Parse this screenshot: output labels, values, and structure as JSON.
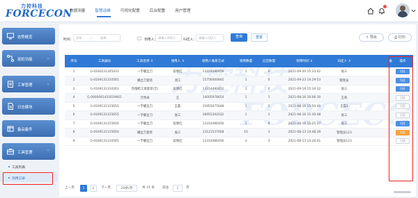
{
  "brand": {
    "cn": "力控科技",
    "en": "FORCECON"
  },
  "nav": [
    {
      "label": "数据测量",
      "active": false
    },
    {
      "label": "智慧运维",
      "active": true
    },
    {
      "label": "可视化配置",
      "active": false
    },
    {
      "label": "后台配置",
      "active": false
    },
    {
      "label": "用户管理",
      "active": false
    }
  ],
  "sidebar": {
    "items": [
      {
        "label": "态势概览",
        "icon": "monitor-icon"
      },
      {
        "label": "巡检功能",
        "icon": "route-icon"
      },
      {
        "label": "工单管理",
        "icon": "clipboard-icon"
      },
      {
        "label": "日志模块",
        "icon": "document-icon"
      },
      {
        "label": "备品备件",
        "icon": "box-icon"
      },
      {
        "label": "工具管理",
        "icon": "toolbox-icon"
      }
    ],
    "sub_items": [
      {
        "label": "工具列表",
        "active": false
      },
      {
        "label": "领用记录",
        "active": true
      }
    ]
  },
  "filters": {
    "time_label": "时间：",
    "start_placeholder": "开始",
    "separator": "—",
    "end_placeholder": "结束",
    "receiver_label": "领用人：",
    "receiver_placeholder": "请输入领用人",
    "returner_label": "归还人：",
    "returner_placeholder": "请输入归还人",
    "query_label": "查询",
    "reset_label": "重置",
    "export_label": "导出",
    "print_label": "打印"
  },
  "table": {
    "columns": [
      "序号",
      "工具编号",
      "工具名称 ⇕",
      "领用人 ⇕",
      "领用人联系方式",
      "领用数量",
      "已还数量",
      "领用时间 ⇕",
      "归还人 ⇕",
      "备",
      "操作"
    ],
    "rows": [
      [
        "1",
        "G-0160231305431",
        "一字螺丝刀",
        "段晓红",
        "13314496456",
        "1",
        "0",
        "2021-09-20 15:33:42",
        "张三",
        "",
        "归还"
      ],
      [
        "2",
        "G-0169131310565",
        "螺丝刀套装",
        "测工",
        "15756000845",
        "1",
        "0",
        "2021-09-23 14:29:53",
        "管理员",
        "",
        "归还"
      ],
      [
        "3",
        "G-0169131310263",
        "热熔枪工具套装(全)",
        "段晓红",
        "13314490432",
        "1",
        "0",
        "2021-09-19 15:34:32",
        "张三",
        "",
        "归还"
      ],
      [
        "4",
        "G-0000091410019601",
        "万用表",
        "王",
        "14005978654",
        "1",
        "1",
        "2021-08-16 16:06:30",
        "王哥",
        "",
        "已还"
      ],
      [
        "5",
        "G-0169131315655",
        "一字螺丝刀",
        "王磊",
        "15955675648",
        "1",
        "1",
        "2021-08-16 15:50:40",
        "王磊1",
        "",
        "已还"
      ],
      [
        "6",
        "G-0169131315655",
        "一字螺丝刀",
        "张三",
        "18955302032",
        "1",
        "1",
        "2021-08-16 15:30:48",
        "张三",
        "",
        "已还"
      ],
      [
        "7",
        "G-0169131315650",
        "一字螺丝刀",
        "段晓红",
        "13314496456",
        "1",
        "0",
        "2021-08-16 15:25:37",
        "张三",
        "",
        "归还"
      ],
      [
        "8",
        "G-0169131315650",
        "螺丝刀套装",
        "张三",
        "13121537608",
        "10",
        "3",
        "2021-08-13 14:48:39",
        "管理员123",
        "",
        "归还"
      ],
      [
        "9",
        "G-0169131310565",
        "一字螺丝刀",
        "段晓红",
        "13314496456",
        "3",
        "3",
        "2021-08-13 14:26:01",
        "管理员123",
        "",
        "已还"
      ]
    ]
  },
  "pager": {
    "prev": "上一页",
    "pages": [
      "1",
      "2"
    ],
    "next": "下一页",
    "page_size": "20条/页",
    "total": "共 31 条",
    "goto_label": "前往",
    "goto_value": "1",
    "page_suffix": "页"
  },
  "colors": {
    "primary": "#2f7ad6",
    "orange": "#f7a23b",
    "highlight": "#e22222"
  }
}
